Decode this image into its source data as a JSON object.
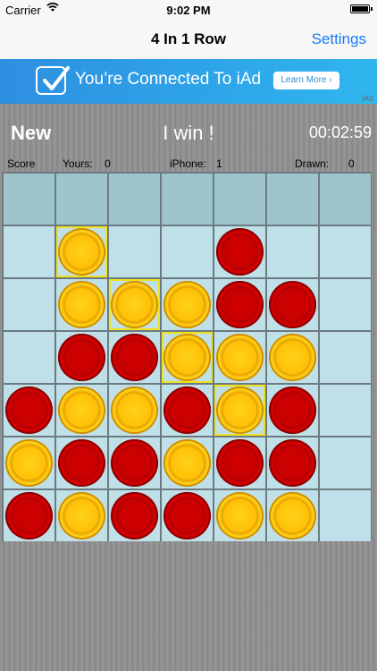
{
  "status": {
    "carrier": "Carrier",
    "time": "9:02 PM"
  },
  "nav": {
    "title": "4 In 1 Row",
    "settings": "Settings"
  },
  "ad": {
    "text": "You’re Connected To iAd",
    "button": "Learn More ›",
    "label": "iAd"
  },
  "game": {
    "new_label": "New",
    "message": "I win !",
    "timer": "00:02:59"
  },
  "score": {
    "score_label": "Score",
    "yours_label": "Yours:",
    "yours_value": "0",
    "iphone_label": "iPhone:",
    "iphone_value": "1",
    "drawn_label": "Drawn:",
    "drawn_value": "0"
  },
  "colors": {
    "red_disc": "#cc0000",
    "yellow_disc": "#ffc107",
    "cell": "#bfe0e8",
    "highlight": "#f0e21c",
    "link": "#1a7cf5"
  },
  "board": {
    "columns": 7,
    "rows": 7,
    "grid": [
      [
        "",
        "",
        "",
        "",
        "",
        "",
        ""
      ],
      [
        "",
        "Y",
        "",
        "",
        "R",
        "",
        ""
      ],
      [
        "",
        "Y",
        "Y",
        "Y",
        "R",
        "R",
        ""
      ],
      [
        "",
        "R",
        "R",
        "Y",
        "Y",
        "Y",
        ""
      ],
      [
        "R",
        "Y",
        "Y",
        "R",
        "Y",
        "R",
        ""
      ],
      [
        "Y",
        "R",
        "R",
        "Y",
        "R",
        "R",
        ""
      ],
      [
        "R",
        "Y",
        "R",
        "R",
        "Y",
        "Y",
        ""
      ]
    ],
    "winning_cells": [
      [
        1,
        1
      ],
      [
        2,
        2
      ],
      [
        3,
        3
      ],
      [
        4,
        4
      ]
    ]
  }
}
